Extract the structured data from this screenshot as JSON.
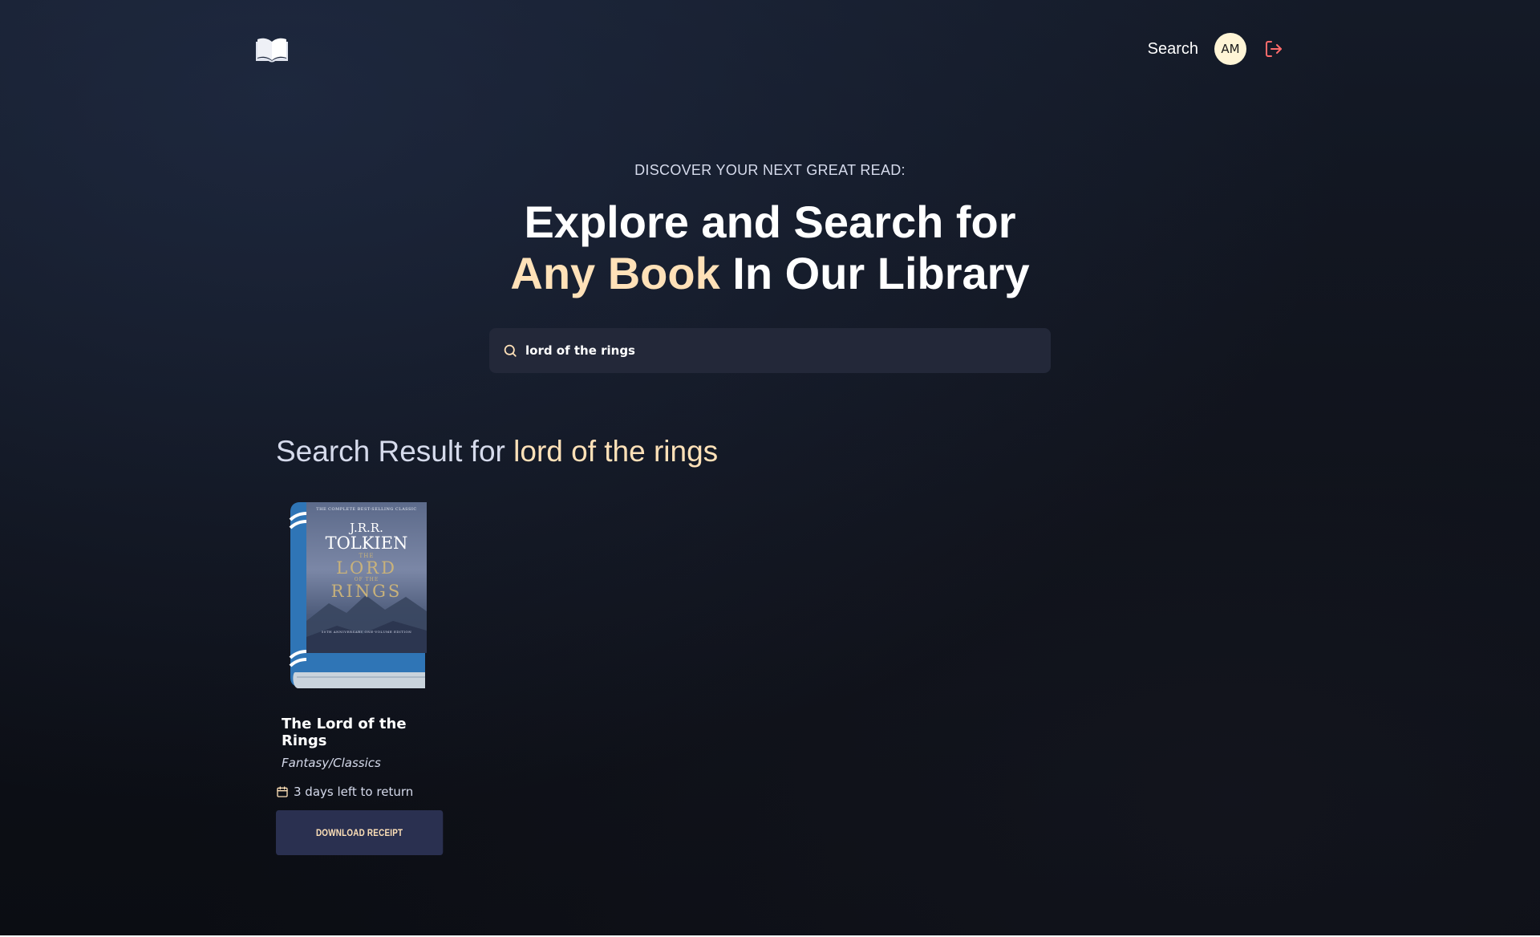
{
  "header": {
    "logo_icon": "open-book-icon",
    "nav_search_label": "Search",
    "avatar_initials": "AM",
    "logout_icon": "logout-icon"
  },
  "hero": {
    "eyebrow": "DISCOVER YOUR NEXT GREAT READ:",
    "line1": "Explore and Search for",
    "line2_accent": "Any Book",
    "line2_rest": " In Our Library"
  },
  "search": {
    "icon": "search-icon",
    "value": "lord of the rings"
  },
  "results": {
    "heading_prefix": "Search Result for ",
    "query": "lord of the rings",
    "books": [
      {
        "title": "The Lord of the Rings",
        "genre": "Fantasy/Classics",
        "due_text": "3 days left to return",
        "button_label": "DOWNLOAD RECEIPT",
        "cover": {
          "top_line": "THE COMPLETE BEST-SELLING CLASSIC",
          "author_line1": "J.R.R.",
          "author_line2": "TOLKIEN",
          "title_line1": "THE",
          "title_line2": "LORD",
          "title_line3": "OF THE",
          "title_line4": "RINGS",
          "bottom_line": "50TH ANNIVERSARY ONE-VOLUME EDITION"
        }
      }
    ]
  },
  "colors": {
    "accent": "#ffe1b8",
    "muted_text": "#d6dbec",
    "search_bg": "#232839",
    "button_bg": "#2a3050",
    "avatar_bg": "#fff5d6",
    "logout": "#ff6b6b",
    "book_spine": "#2f75b6"
  }
}
